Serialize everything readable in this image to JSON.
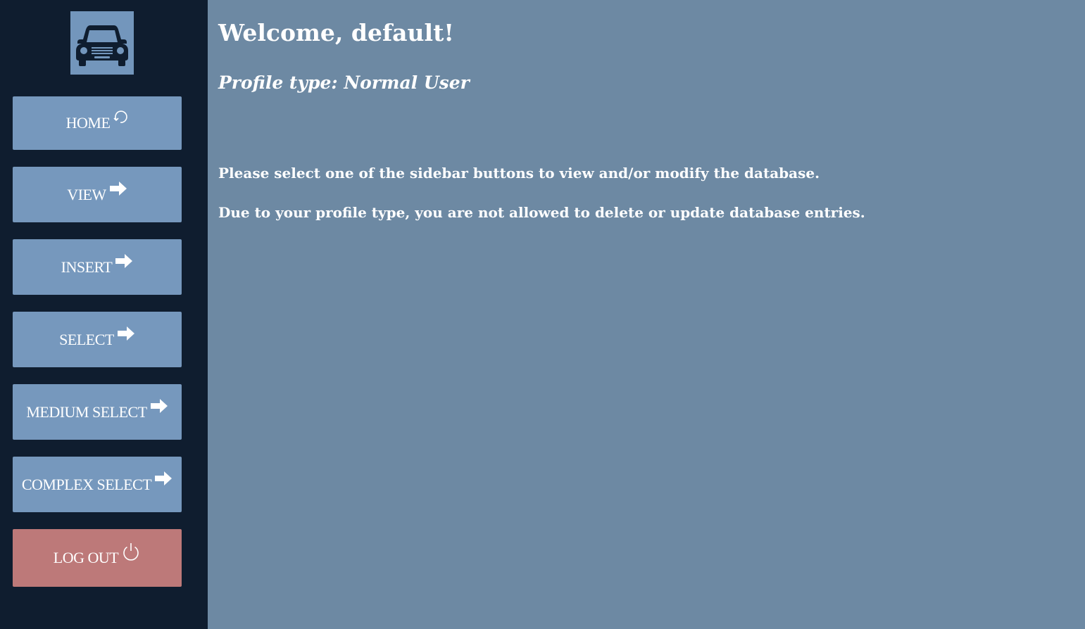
{
  "sidebar": {
    "logo_icon": "car-icon",
    "items": [
      {
        "label": "HOME",
        "icon": "refresh-icon"
      },
      {
        "label": "VIEW",
        "icon": "arrow-right-icon"
      },
      {
        "label": "INSERT",
        "icon": "arrow-right-icon"
      },
      {
        "label": "SELECT",
        "icon": "arrow-right-icon"
      },
      {
        "label": "MEDIUM SELECT",
        "icon": "arrow-right-icon"
      },
      {
        "label": "COMPLEX SELECT",
        "icon": "arrow-right-icon"
      }
    ],
    "logout": {
      "label": "LOG OUT",
      "icon": "power-icon"
    }
  },
  "main": {
    "welcome": "Welcome, default!",
    "profile_type": "Profile type: Normal User",
    "message_1": "Please select one of the sidebar buttons to view and/or modify the database.",
    "message_2": "Due to your profile type, you are not allowed to delete or update database entries."
  },
  "colors": {
    "sidebar_bg": "#0f1d2f",
    "main_bg": "#6d89a3",
    "button_bg": "#7698bd",
    "logout_bg": "#bd7979"
  }
}
